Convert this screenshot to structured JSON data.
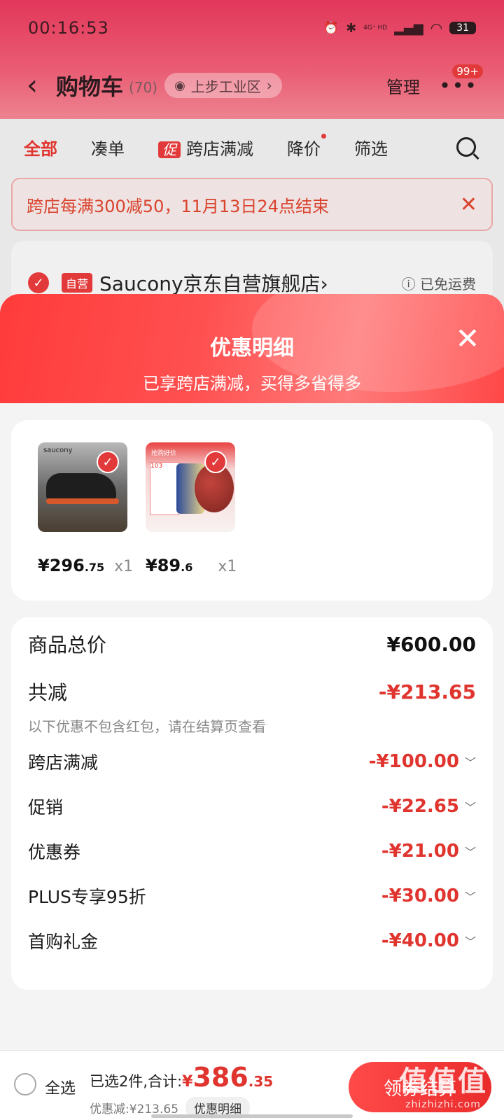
{
  "status_bar": {
    "time": "00:16:53",
    "network": "4G⁺ HD",
    "battery": "31"
  },
  "header": {
    "back_icon": "chevron-left-icon",
    "title": "购物车",
    "count": "(70)",
    "location": "上步工业区",
    "location_chevron": "›",
    "manage": "管理",
    "more_badge": "99+"
  },
  "filters": {
    "items": [
      "全部",
      "凑单",
      "跨店满减",
      "降价",
      "筛选"
    ],
    "promo_tag": "促"
  },
  "promo_banner": {
    "text": "跨店每满300减50，11月13日24点结束",
    "close": "✕"
  },
  "shop": {
    "self_tag": "自营",
    "name": "Saucony京东自营旗舰店",
    "chevron": "›",
    "shipping": "ⓘ 已免运费"
  },
  "sheet": {
    "title": "优惠明细",
    "subtitle": "已享跨店满减，买得多省得多",
    "close": "✕"
  },
  "goods": [
    {
      "logo": "saucony",
      "sym": "¥",
      "int": "296",
      "dec": ".75",
      "qty": "x1"
    },
    {
      "tag": "抢购好价",
      "panel": "103",
      "sym": "¥",
      "int": "89",
      "dec": ".6",
      "qty": "x1"
    }
  ],
  "details": {
    "total_label": "商品总价",
    "total_amount": "¥600.00",
    "reduce_label": "共减",
    "reduce_amount": "-¥213.65",
    "note": "以下优惠不包含红包，请在结算页查看",
    "rows": [
      {
        "label": "跨店满减",
        "amount": "-¥100.00"
      },
      {
        "label": "促销",
        "amount": "-¥22.65"
      },
      {
        "label": "优惠券",
        "amount": "-¥21.00"
      },
      {
        "label": "PLUS专享95折",
        "amount": "-¥30.00"
      },
      {
        "label": "首购礼金",
        "amount": "-¥40.00"
      }
    ],
    "chevron": "﹀"
  },
  "bottom": {
    "select_all": "全选",
    "summary_text": "已选2件,合计:",
    "sym": "¥",
    "int": "386",
    "dec": ".35",
    "discount_text": "优惠减:¥213.65",
    "detail_pill": "优惠明细",
    "checkout": "领券结算"
  },
  "watermark": {
    "big": "值值值",
    "small": "zhizhizhi.com"
  },
  "colors": {
    "accent_red": "#e0342e",
    "header_pink": "#e2375a",
    "sheet_red": "#ff3b3b"
  }
}
